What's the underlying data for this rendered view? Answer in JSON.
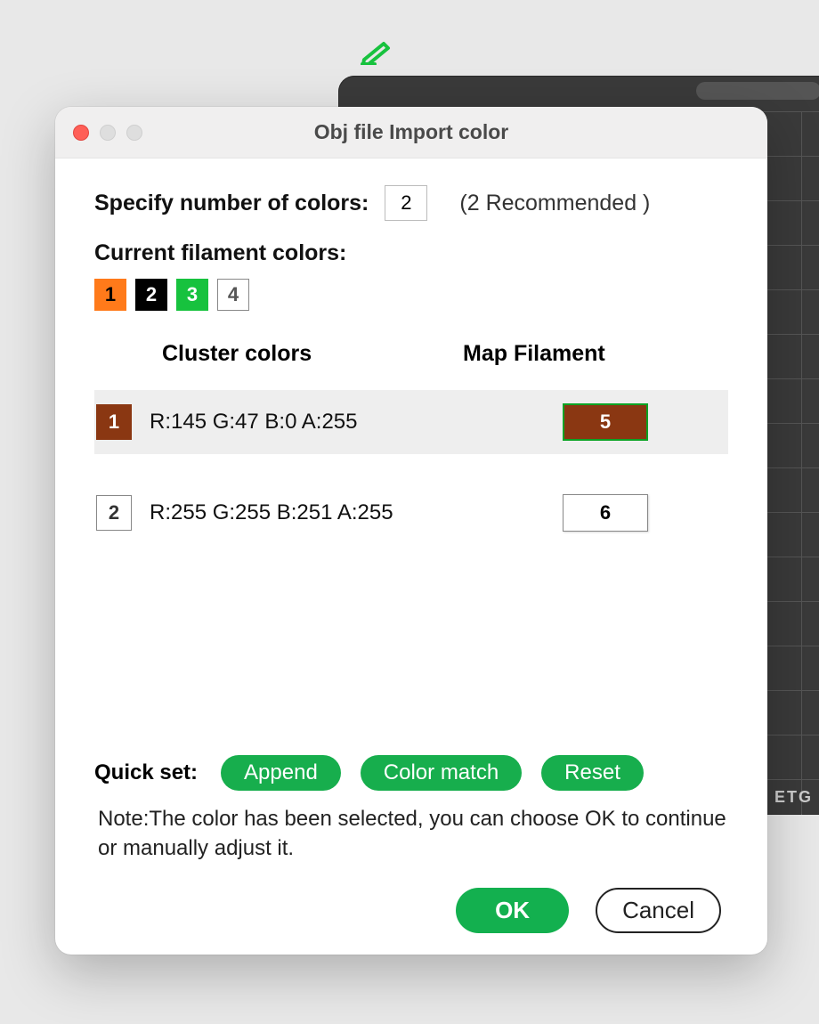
{
  "dialog": {
    "title": "Obj file Import color",
    "specify_label": "Specify number of colors:",
    "specify_value": "2",
    "recommended_text": "(2 Recommended )",
    "current_label": "Current filament colors:",
    "filament_swatches": [
      {
        "num": "1",
        "bg": "#ff7a1a",
        "fg": "#000000",
        "border": "#ff7a1a"
      },
      {
        "num": "2",
        "bg": "#000000",
        "fg": "#ffffff",
        "border": "#000000"
      },
      {
        "num": "3",
        "bg": "#17c23e",
        "fg": "#ffffff",
        "border": "#17c23e"
      },
      {
        "num": "4",
        "bg": "#ffffff",
        "fg": "#555555",
        "border": "#888888"
      }
    ],
    "th_cluster": "Cluster colors",
    "th_map": "Map Filament",
    "clusters": [
      {
        "selected": true,
        "swatch_num": "1",
        "swatch_bg": "#8a3712",
        "swatch_fg": "#ffffff",
        "rgba": "R:145 G:47 B:0 A:255",
        "map_value": "5",
        "map_selected": true,
        "map_bg": "#8a3712",
        "map_fg": "#ffffff"
      },
      {
        "selected": false,
        "swatch_num": "2",
        "swatch_bg": "#ffffff",
        "swatch_fg": "#333333",
        "rgba": "R:255 G:255 B:251 A:255",
        "map_value": "6",
        "map_selected": false,
        "map_bg": "#ffffff",
        "map_fg": "#000000"
      }
    ],
    "quickset_label": "Quick set:",
    "quickset_buttons": {
      "append": "Append",
      "color_match": "Color match",
      "reset": "Reset"
    },
    "note": "Note:The color has been selected, you can choose OK to continue or manually adjust it.",
    "ok_label": "OK",
    "cancel_label": "Cancel"
  },
  "background": {
    "tag_text": "ETG"
  }
}
